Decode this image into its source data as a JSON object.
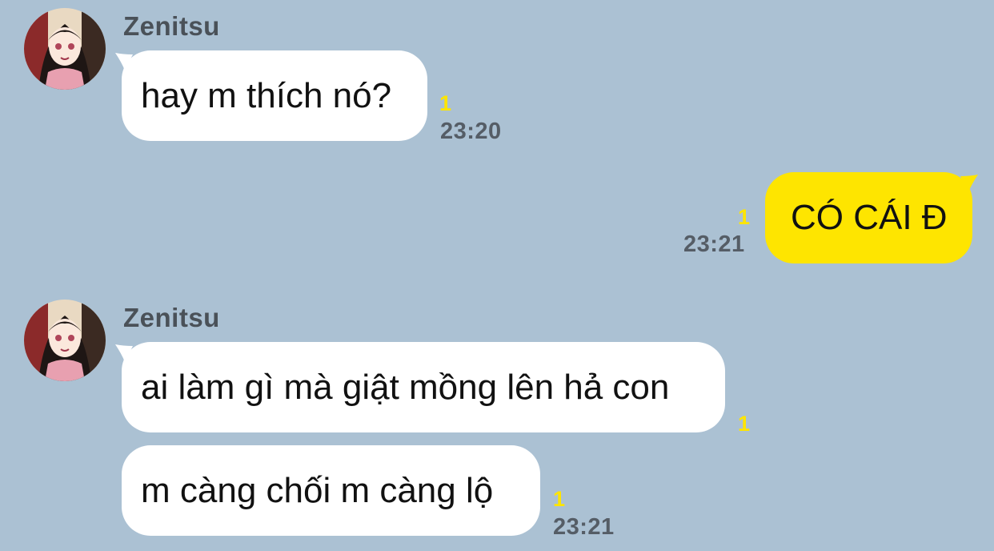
{
  "messages": [
    {
      "sender": "Zenitsu",
      "text": "hay m thích nó?",
      "unread": "1",
      "time": "23:20"
    },
    {
      "text": "CÓ CÁI Đ",
      "unread": "1",
      "time": "23:21"
    },
    {
      "sender": "Zenitsu",
      "text": "ai làm gì mà giật mồng lên hả con",
      "unread": "1"
    },
    {
      "text": "m càng chối m càng lộ",
      "unread": "1",
      "time": "23:21"
    }
  ],
  "colors": {
    "background": "#abc1d3",
    "incoming_bubble": "#ffffff",
    "outgoing_bubble": "#fee500",
    "unread_count": "#fee500"
  }
}
